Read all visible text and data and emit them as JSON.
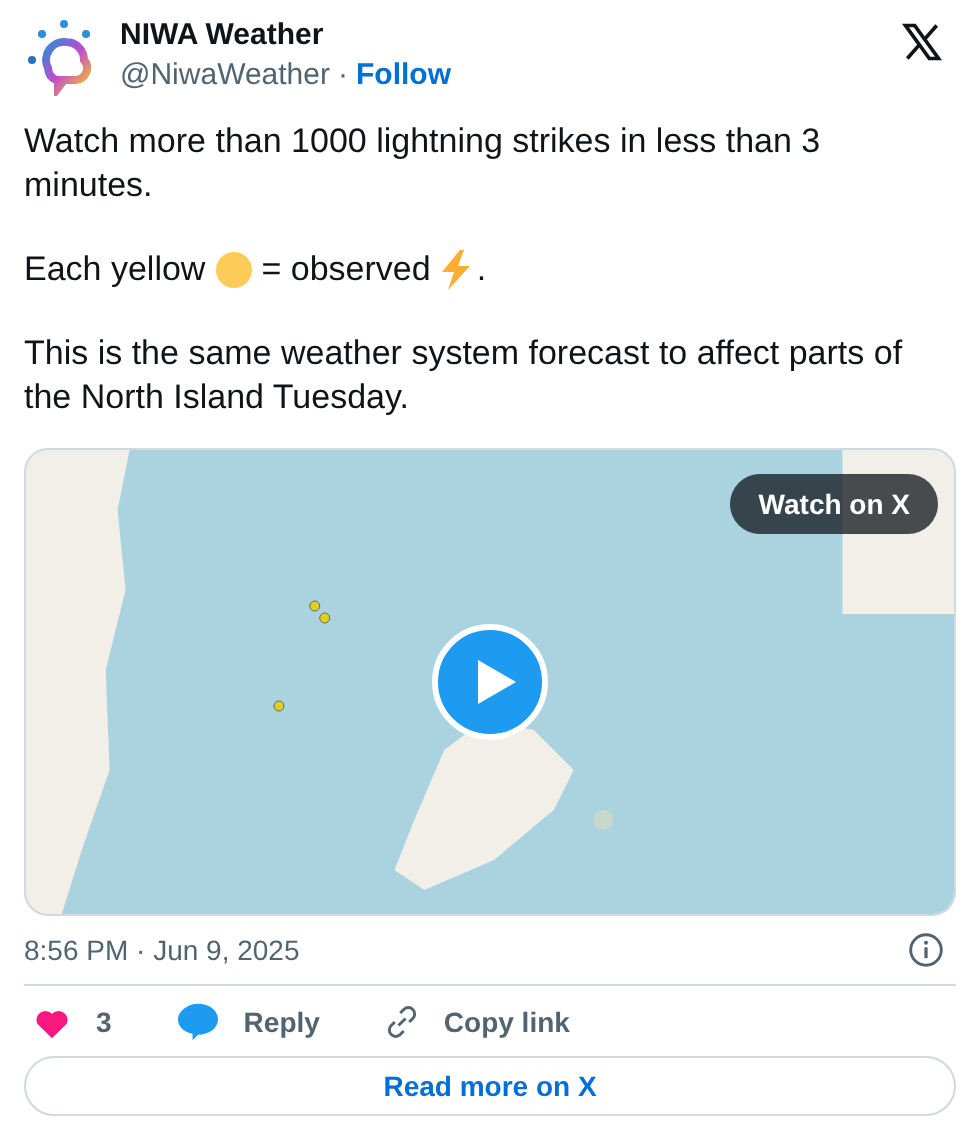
{
  "author": {
    "name": "NIWA Weather",
    "handle": "@NiwaWeather",
    "separator": "·",
    "follow": "Follow"
  },
  "tweet": {
    "paragraphs": [
      {
        "kind": "text",
        "text": "Watch more than 1000 lightning strikes in less than 3 minutes."
      },
      {
        "kind": "legend",
        "parts": [
          "Each yellow",
          "= observed",
          "."
        ]
      },
      {
        "kind": "text",
        "text": "This is the same weather system forecast to affect parts of the North Island Tuesday."
      }
    ]
  },
  "media": {
    "kind": "picture",
    "watch_button": "Watch on X"
  },
  "timestamp": "8:56 PM · Jun 9, 2025",
  "actions": {
    "likes": "3",
    "reply": "Reply",
    "copy_link": "Copy link"
  },
  "read_more": "Read more on X"
}
